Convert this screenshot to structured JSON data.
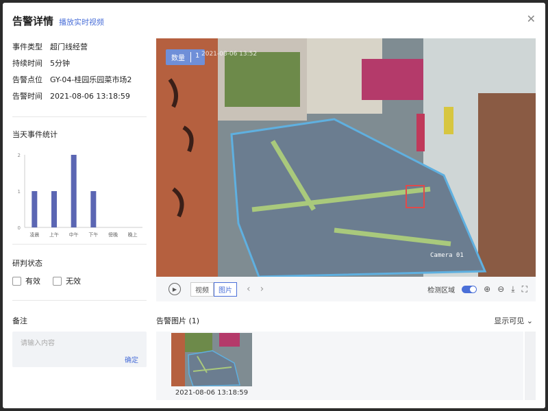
{
  "header": {
    "title": "告警详情",
    "live_link": "播放实时视频"
  },
  "info": {
    "rows": [
      {
        "key": "事件类型",
        "value": "超门线经营"
      },
      {
        "key": "持续时间",
        "value": "5分钟"
      },
      {
        "key": "告警点位",
        "value": "GY-04-桂园乐园菜市场2"
      },
      {
        "key": "告警时间",
        "value": "2021-08-06 13:18:59"
      }
    ]
  },
  "stats": {
    "label": "当天事件统计"
  },
  "chart_data": {
    "type": "bar",
    "categories": [
      "凌晨",
      "上午",
      "中午",
      "下午",
      "傍晚",
      "晚上"
    ],
    "values": [
      1,
      1,
      2,
      1,
      0,
      0
    ],
    "ylim": [
      0,
      2
    ],
    "yticks": [
      0,
      1,
      2
    ],
    "color": "#5b66b3"
  },
  "judge": {
    "label": "研判状态",
    "options": [
      "有效",
      "无效"
    ]
  },
  "note": {
    "label": "备注",
    "placeholder": "请输入内容",
    "confirm": "确定"
  },
  "video": {
    "badge": "数量",
    "badge_count": "1",
    "camera": "Camera 01",
    "timestamp": "2021-08-06 13:52"
  },
  "toolbar": {
    "video_tab": "视频",
    "image_tab": "图片",
    "detect_area": "检测区域"
  },
  "alarm_images": {
    "label": "告警图片",
    "count": "(1)",
    "visible": "显示可见",
    "items": [
      {
        "time": "2021-08-06 13:18:59"
      }
    ]
  }
}
